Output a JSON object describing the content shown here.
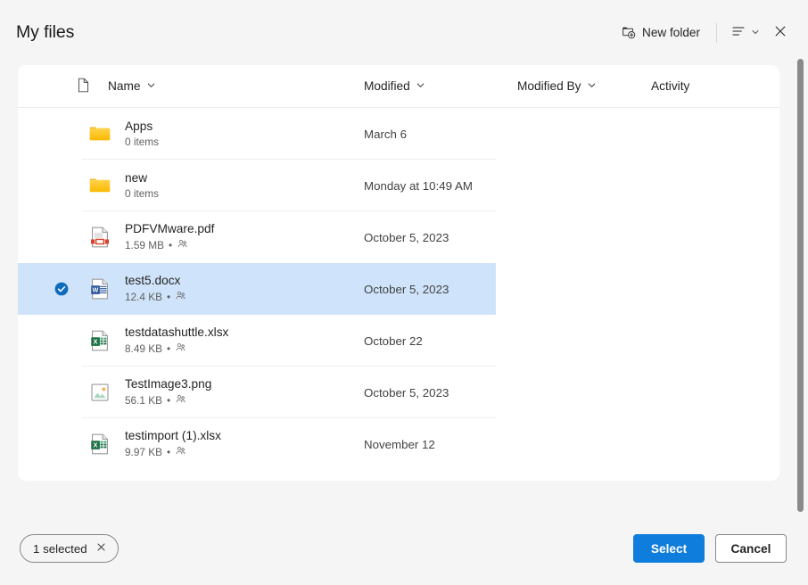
{
  "header": {
    "title": "My files",
    "new_folder_label": "New folder",
    "new_folder_icon": "folder-plus-icon",
    "view_options_icon": "list-view-icon",
    "view_chevron_icon": "chevron-down-icon",
    "close_icon": "close-icon"
  },
  "columns": {
    "file_type_icon": "file-type-icon",
    "name": "Name",
    "modified": "Modified",
    "modified_by": "Modified By",
    "activity": "Activity",
    "sort_chevron_icon": "chevron-down-icon"
  },
  "rows": [
    {
      "name": "Apps",
      "sub": "0 items",
      "shared": false,
      "modified": "March 6",
      "modified_by": "",
      "activity": "",
      "icon": "folder-icon",
      "selected": false
    },
    {
      "name": "new",
      "sub": "0 items",
      "shared": false,
      "modified": "Monday at 10:49 AM",
      "modified_by": "",
      "activity": "",
      "icon": "folder-icon",
      "selected": false
    },
    {
      "name": "PDFVMware.pdf",
      "sub": "1.59 MB",
      "shared": true,
      "modified": "October 5, 2023",
      "modified_by": "",
      "activity": "",
      "icon": "pdf-file-icon",
      "selected": false
    },
    {
      "name": "test5.docx",
      "sub": "12.4 KB",
      "shared": true,
      "modified": "October 5, 2023",
      "modified_by": "",
      "activity": "",
      "icon": "word-file-icon",
      "selected": true
    },
    {
      "name": "testdatashuttle.xlsx",
      "sub": "8.49 KB",
      "shared": true,
      "modified": "October 22",
      "modified_by": "",
      "activity": "",
      "icon": "excel-file-icon",
      "selected": false
    },
    {
      "name": "TestImage3.png",
      "sub": "56.1 KB",
      "shared": true,
      "modified": "October 5, 2023",
      "modified_by": "",
      "activity": "",
      "icon": "image-file-icon",
      "selected": false
    },
    {
      "name": "testimport (1).xlsx",
      "sub": "9.97 KB",
      "shared": true,
      "modified": "November 12",
      "modified_by": "",
      "activity": "",
      "icon": "excel-file-icon",
      "selected": false
    }
  ],
  "footer": {
    "selection_chip": "1 selected",
    "selection_clear_icon": "close-icon",
    "select_label": "Select",
    "cancel_label": "Cancel"
  },
  "colors": {
    "accent": "#0f7ddb",
    "selected_row": "#cfe4fa",
    "page_background": "#f5f5f5",
    "card_background": "#ffffff",
    "folder": "#ffc107",
    "excel_green": "#1e7145",
    "word_blue": "#2b579a",
    "pdf_red": "#d04423"
  }
}
